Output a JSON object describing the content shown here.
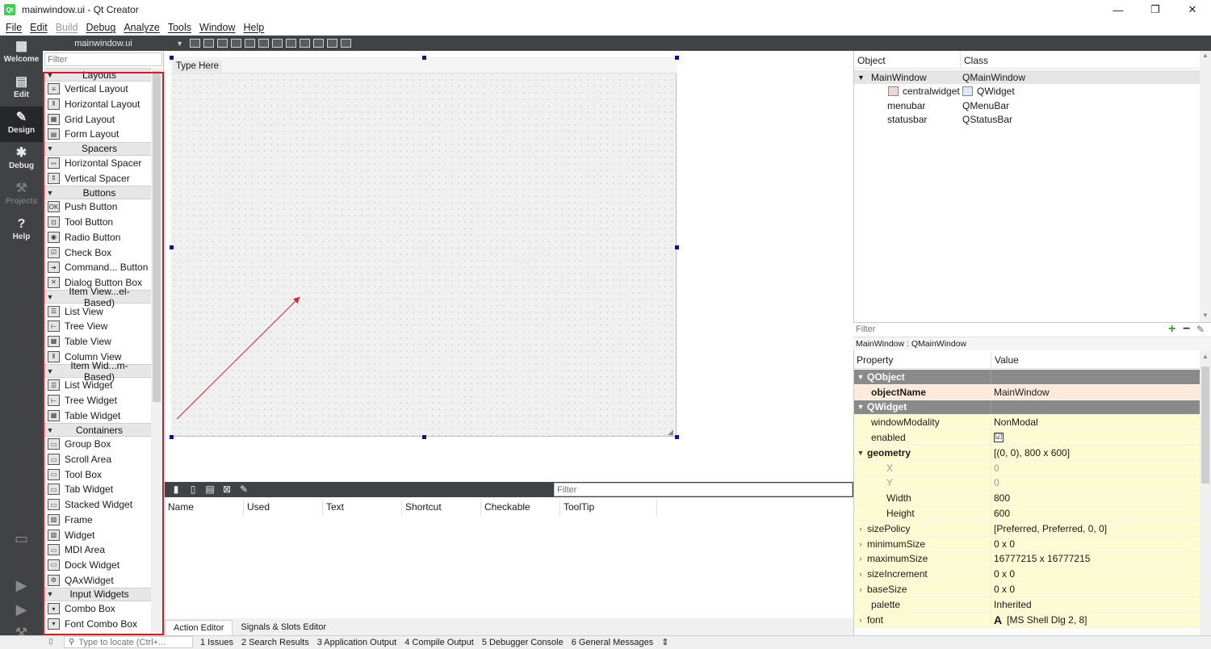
{
  "window": {
    "title": "mainwindow.ui - Qt Creator",
    "app_icon_text": "Qt",
    "minimize": "—",
    "maximize": "❐",
    "close": "✕"
  },
  "menubar": {
    "items": [
      {
        "label": "File",
        "enabled": true
      },
      {
        "label": "Edit",
        "enabled": true
      },
      {
        "label": "Build",
        "enabled": false
      },
      {
        "label": "Debug",
        "enabled": true
      },
      {
        "label": "Analyze",
        "enabled": true
      },
      {
        "label": "Tools",
        "enabled": true
      },
      {
        "label": "Window",
        "enabled": true
      },
      {
        "label": "Help",
        "enabled": true
      }
    ]
  },
  "modes": [
    {
      "label": "Welcome",
      "icon": "welcome-grid-icon"
    },
    {
      "label": "Edit",
      "icon": "edit-document-icon"
    },
    {
      "label": "Design",
      "icon": "design-pencil-icon",
      "active": true
    },
    {
      "label": "Debug",
      "icon": "debug-bug-icon"
    },
    {
      "label": "Projects",
      "icon": "projects-wrench-icon",
      "disabled": true
    },
    {
      "label": "Help",
      "icon": "help-question-icon"
    }
  ],
  "editor_toolbar": {
    "document": "mainwindow.ui"
  },
  "widgetbox": {
    "filter_placeholder": "Filter",
    "categories": [
      {
        "name": "Layouts",
        "items": [
          "Vertical Layout",
          "Horizontal Layout",
          "Grid Layout",
          "Form Layout"
        ]
      },
      {
        "name": "Spacers",
        "items": [
          "Horizontal Spacer",
          "Vertical Spacer"
        ]
      },
      {
        "name": "Buttons",
        "items": [
          "Push Button",
          "Tool Button",
          "Radio Button",
          "Check Box",
          "Command... Button",
          "Dialog Button Box"
        ]
      },
      {
        "name": "Item View...el-Based)",
        "items": [
          "List View",
          "Tree View",
          "Table View",
          "Column View"
        ]
      },
      {
        "name": "Item Wid...m-Based)",
        "items": [
          "List Widget",
          "Tree Widget",
          "Table Widget"
        ]
      },
      {
        "name": "Containers",
        "items": [
          "Group Box",
          "Scroll Area",
          "Tool Box",
          "Tab Widget",
          "Stacked Widget",
          "Frame",
          "Widget",
          "MDI Area",
          "Dock Widget",
          "QAxWidget"
        ]
      },
      {
        "name": "Input Widgets",
        "items": [
          "Combo Box",
          "Font Combo Box"
        ]
      }
    ],
    "highlight_color": "#d81b23"
  },
  "form": {
    "menu_placeholder": "Type Here"
  },
  "action_editor": {
    "filter_placeholder": "Filter",
    "columns": [
      "Name",
      "Used",
      "Text",
      "Shortcut",
      "Checkable",
      "ToolTip"
    ],
    "tabs": [
      {
        "label": "Action Editor",
        "active": true
      },
      {
        "label": "Signals & Slots Editor",
        "active": false
      }
    ]
  },
  "object_inspector": {
    "columns": [
      "Object",
      "Class"
    ],
    "rows": [
      {
        "object": "MainWindow",
        "class": "QMainWindow",
        "selected": true,
        "expanded": true
      },
      {
        "object": "centralwidget",
        "class": "QWidget",
        "has_icon": true
      },
      {
        "object": "menubar",
        "class": "QMenuBar"
      },
      {
        "object": "statusbar",
        "class": "QStatusBar"
      }
    ]
  },
  "property_editor": {
    "filter_placeholder": "Filter",
    "context": "MainWindow : QMainWindow",
    "columns": [
      "Property",
      "Value"
    ],
    "rows": [
      {
        "name": "QObject",
        "value": "",
        "kind": "section"
      },
      {
        "name": "objectName",
        "value": "MainWindow",
        "kind": "obj",
        "bold": true
      },
      {
        "name": "QWidget",
        "value": "",
        "kind": "section"
      },
      {
        "name": "windowModality",
        "value": "NonModal",
        "kind": "wid"
      },
      {
        "name": "enabled",
        "value": "☑",
        "kind": "wid",
        "checkbox": true
      },
      {
        "name": "geometry",
        "value": "[(0, 0), 800 x 600]",
        "kind": "wid",
        "bold": true,
        "expander": "open"
      },
      {
        "name": "X",
        "value": "0",
        "kind": "wid",
        "indent": true,
        "dim": true
      },
      {
        "name": "Y",
        "value": "0",
        "kind": "wid",
        "indent": true,
        "dim": true
      },
      {
        "name": "Width",
        "value": "800",
        "kind": "wid",
        "indent": true
      },
      {
        "name": "Height",
        "value": "600",
        "kind": "wid",
        "indent": true
      },
      {
        "name": "sizePolicy",
        "value": "[Preferred, Preferred, 0, 0]",
        "kind": "wid",
        "expander": "closed"
      },
      {
        "name": "minimumSize",
        "value": "0 x 0",
        "kind": "wid",
        "expander": "closed"
      },
      {
        "name": "maximumSize",
        "value": "16777215 x 16777215",
        "kind": "wid",
        "expander": "closed"
      },
      {
        "name": "sizeIncrement",
        "value": "0 x 0",
        "kind": "wid",
        "expander": "closed"
      },
      {
        "name": "baseSize",
        "value": "0 x 0",
        "kind": "wid",
        "expander": "closed"
      },
      {
        "name": "palette",
        "value": "Inherited",
        "kind": "wid"
      },
      {
        "name": "font",
        "value": "[MS Shell Dlg 2, 8]",
        "kind": "wid",
        "expander": "closed",
        "font_icon": "A"
      }
    ]
  },
  "statusbar": {
    "locator_placeholder": "Type to locate (Ctrl+...",
    "items": [
      "1  Issues",
      "2  Search Results",
      "3  Application Output",
      "4  Compile Output",
      "5  Debugger Console",
      "6  General Messages"
    ],
    "more": "⇕"
  }
}
